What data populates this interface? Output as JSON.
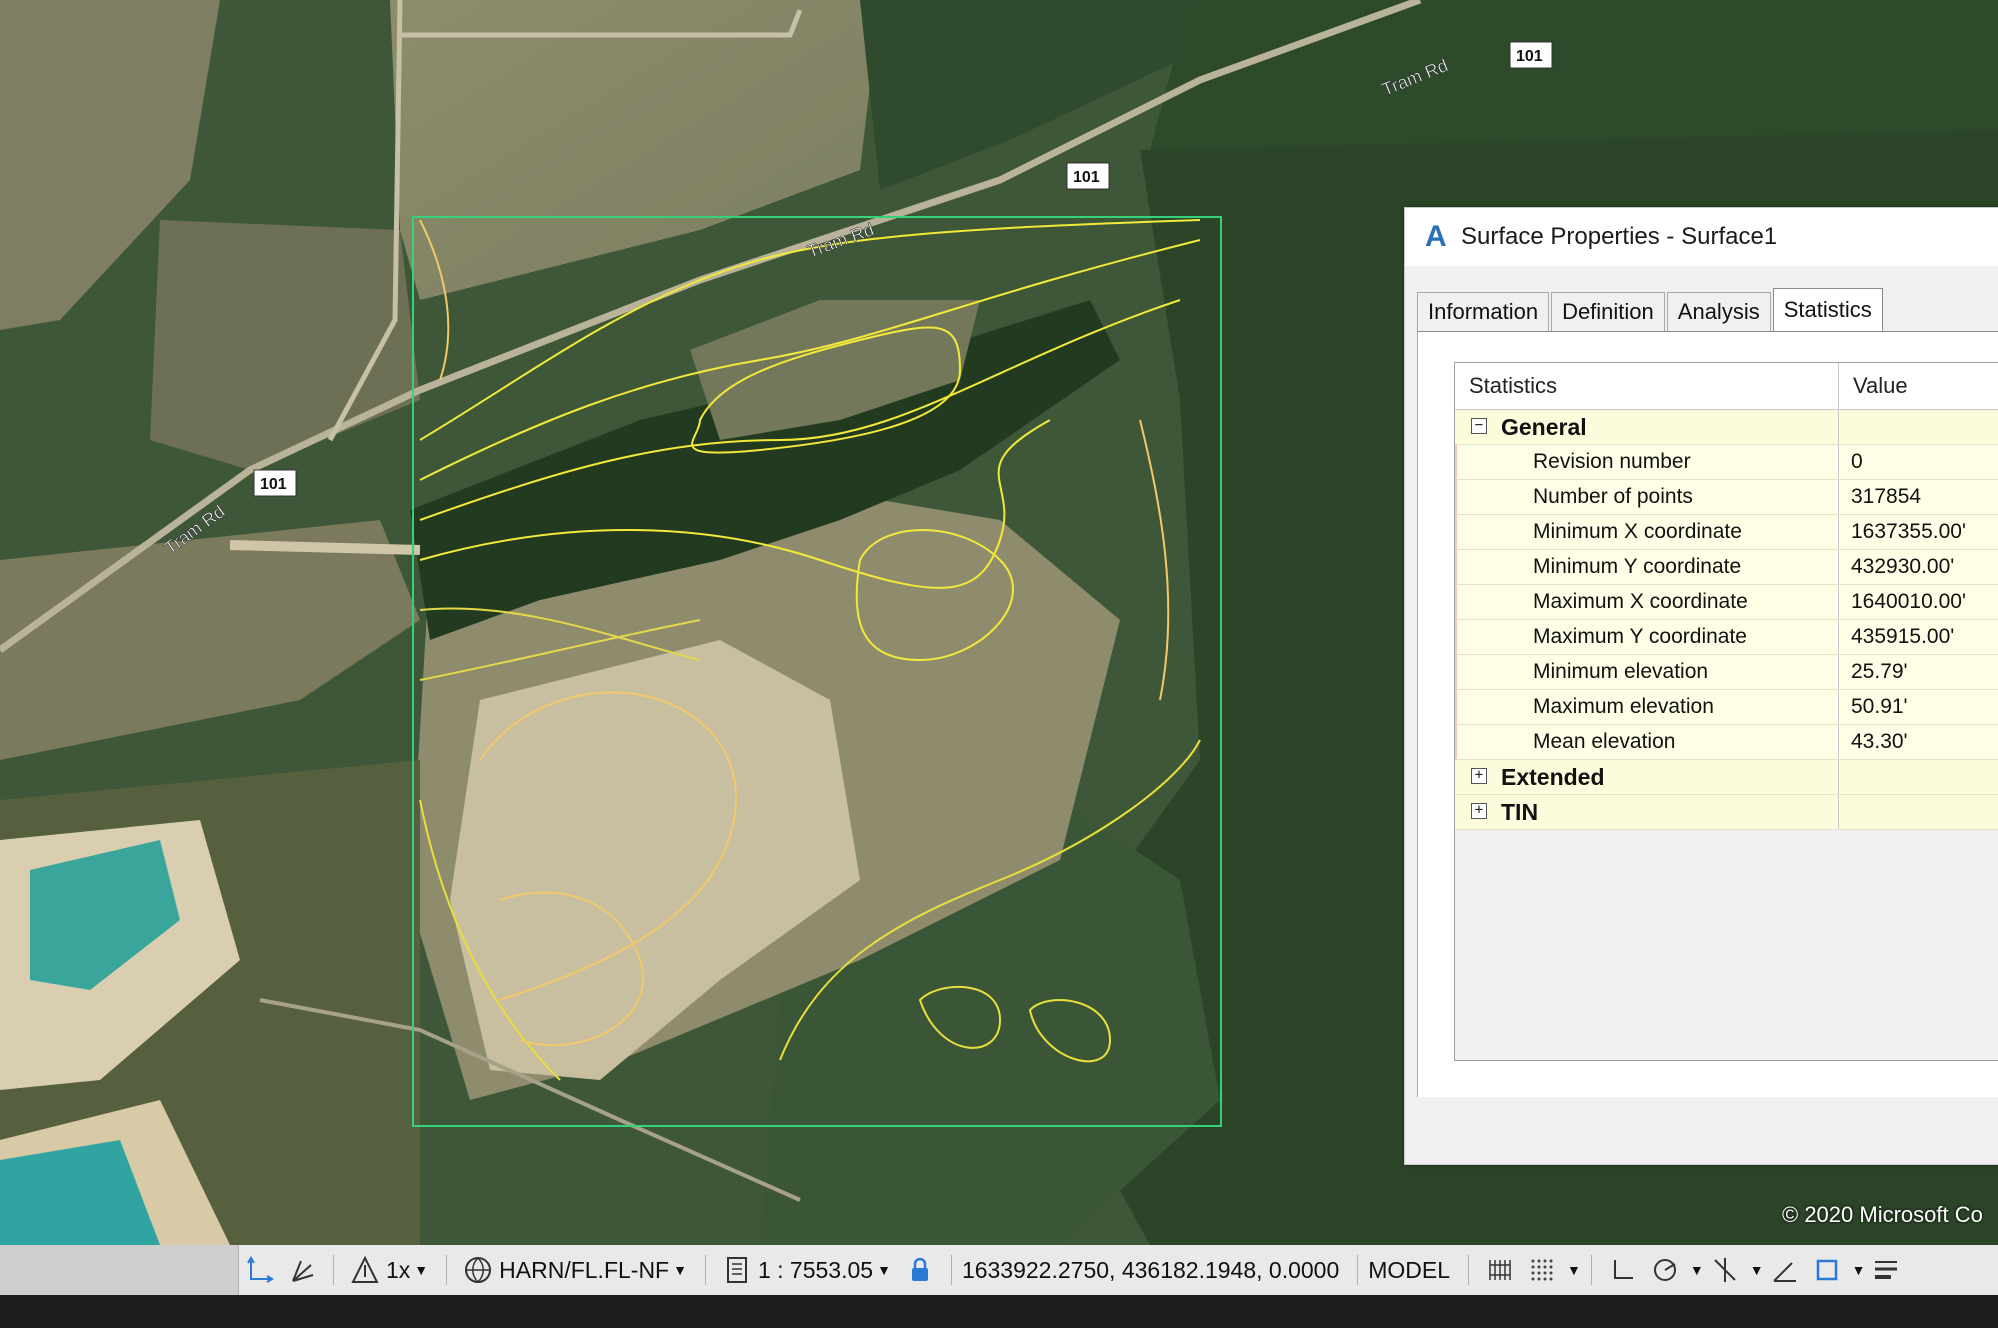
{
  "map": {
    "road_labels": [
      "Tram Rd",
      "Tram Rd",
      "Tram Rd"
    ],
    "route_shields": [
      "101",
      "101",
      "101"
    ],
    "copyright": "© 2020 Microsoft Co",
    "colors": {
      "boundary": "#34d27a",
      "contour_major": "#f2e93a",
      "contour_minor": "#f3c86a"
    }
  },
  "dialog": {
    "title": "Surface Properties - Surface1",
    "icon": "autocad-civil-icon",
    "tabs": [
      "Information",
      "Definition",
      "Analysis",
      "Statistics"
    ],
    "active_tab": "Statistics",
    "grid": {
      "headers": [
        "Statistics",
        "Value"
      ],
      "general": {
        "label": "General",
        "expander": "⊟",
        "rows": [
          {
            "k": "Revision number",
            "v": "0"
          },
          {
            "k": "Number of points",
            "v": "317854"
          },
          {
            "k": "Minimum X coordinate",
            "v": "1637355.00'"
          },
          {
            "k": "Minimum Y coordinate",
            "v": "432930.00'"
          },
          {
            "k": "Maximum X coordinate",
            "v": "1640010.00'"
          },
          {
            "k": "Maximum Y coordinate",
            "v": "435915.00'"
          },
          {
            "k": "Minimum elevation",
            "v": "25.79'"
          },
          {
            "k": "Maximum elevation",
            "v": "50.91'"
          },
          {
            "k": "Mean elevation",
            "v": "43.30'"
          }
        ]
      },
      "extended": {
        "label": "Extended",
        "expander": "⊞"
      },
      "tin": {
        "label": "TIN",
        "expander": "⊞"
      }
    }
  },
  "statusbar": {
    "annoscale": "1x",
    "coord_system": "HARN/FL.FL-NF",
    "scale": "1 : 7553.05",
    "coordinates": "1633922.2750, 436182.1948, 0.0000",
    "space": "MODEL"
  }
}
